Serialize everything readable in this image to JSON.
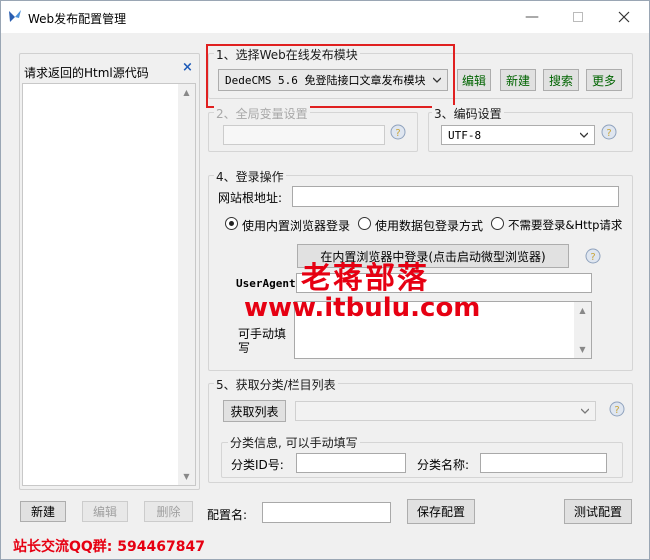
{
  "window": {
    "title": "Web发布配置管理"
  },
  "left_panel": {
    "title": "请求返回的Html源代码",
    "close_symbol": "×"
  },
  "section1": {
    "legend": "1、选择Web在线发布模块",
    "module_value": "DedeCMS 5.6 免登陆接口文章发布模块",
    "buttons": {
      "edit": "编辑",
      "new": "新建",
      "search": "搜索",
      "more": "更多"
    }
  },
  "section2": {
    "legend": "2、全局变量设置"
  },
  "section3": {
    "legend": "3、编码设置",
    "encoding_value": "UTF-8"
  },
  "section4": {
    "legend": "4、登录操作",
    "site_root_label": "网站根地址:",
    "site_root_value": "",
    "radio_options": [
      {
        "label": "使用内置浏览器登录",
        "checked": true
      },
      {
        "label": "使用数据包登录方式",
        "checked": false
      },
      {
        "label": "不需要登录&Http请求",
        "checked": false
      }
    ],
    "browser_login_button": "在内置浏览器中登录(点击启动微型浏览器)",
    "useragent_label": "UserAgent",
    "cookie_label_line2": "可手动填",
    "cookie_label_line3": "写"
  },
  "section5": {
    "legend": "5、获取分类/栏目列表",
    "get_list_button": "获取列表",
    "category_info_legend": "分类信息, 可以手动填写",
    "category_id_label": "分类ID号:",
    "category_name_label": "分类名称:"
  },
  "bottom": {
    "new_button": "新建",
    "edit_button": "编辑",
    "delete_button": "删除",
    "config_name_label": "配置名:",
    "config_name_value": "",
    "save_button": "保存配置",
    "test_button": "测试配置"
  },
  "watermark": {
    "line1": "老蒋部落",
    "line2": "www.itbulu.com",
    "footer": "站长交流QQ群: 594467847"
  },
  "colors": {
    "highlight_box": "#e02020",
    "watermark": "#e60012",
    "link_blue": "#1e5bb8"
  },
  "icons": {
    "help": "help-question-icon",
    "app": "app-logo-icon",
    "close": "close-icon"
  }
}
